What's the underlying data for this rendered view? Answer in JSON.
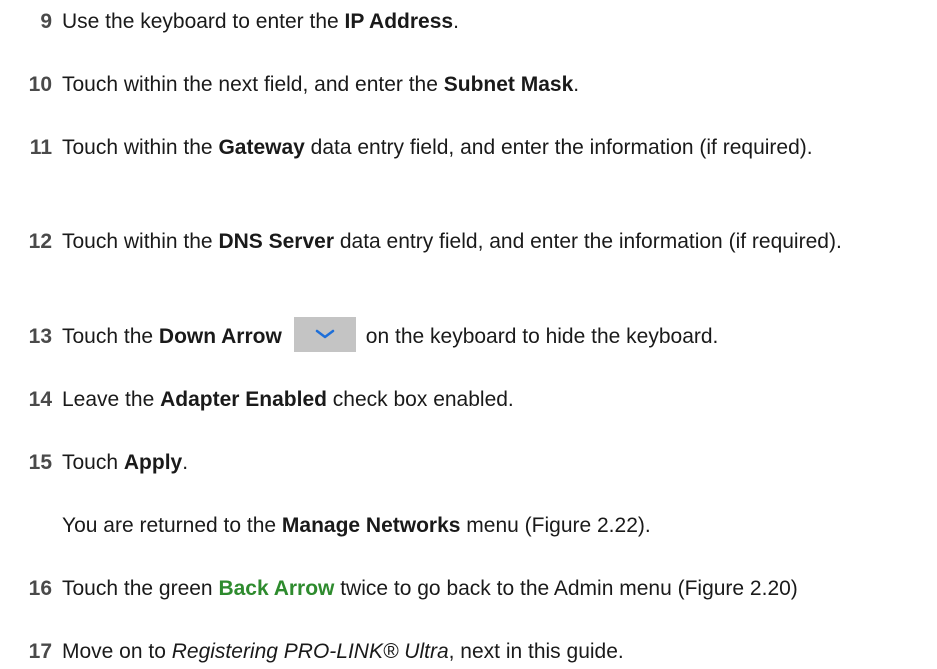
{
  "steps": [
    {
      "num": "9",
      "parts": [
        "Use the keyboard to enter the ",
        "IP Address",
        "."
      ]
    },
    {
      "num": "10",
      "parts": [
        "Touch within the next field, and enter the ",
        "Subnet Mask",
        "."
      ]
    },
    {
      "num": "11",
      "parts": [
        "Touch within the ",
        "Gateway",
        " data entry field, and enter the information (if required)."
      ]
    },
    {
      "num": "12",
      "parts": [
        "Touch within the ",
        "DNS Server",
        " data entry field, and enter the information (if required)."
      ]
    },
    {
      "num": "13",
      "parts": [
        "Touch the ",
        "Down Arrow",
        "on the keyboard to hide the keyboard."
      ],
      "icon": "chevron-down-icon"
    },
    {
      "num": "14",
      "parts": [
        "Leave the ",
        "Adapter Enabled",
        " check box enabled."
      ]
    },
    {
      "num": "15",
      "parts": [
        "Touch ",
        "Apply",
        "."
      ]
    },
    {
      "num": "",
      "parts": [
        "You are returned to the ",
        "Manage Networks",
        " menu (Figure 2.22)."
      ]
    },
    {
      "num": "16",
      "parts": [
        "Touch the green ",
        "Back Arrow",
        " twice to go back to the Admin menu (Figure 2.20)"
      ]
    },
    {
      "num": "17",
      "parts": [
        "Move on to ",
        "Registering PRO-LINK® Ultra",
        ", next in this guide."
      ]
    }
  ],
  "colors": {
    "text": "#1a1a1a",
    "number": "#4a4a4a",
    "green_link": "#2e8b2e",
    "arrow_button_bg": "#c4c4c4",
    "arrow_icon": "#1e6fd9"
  }
}
